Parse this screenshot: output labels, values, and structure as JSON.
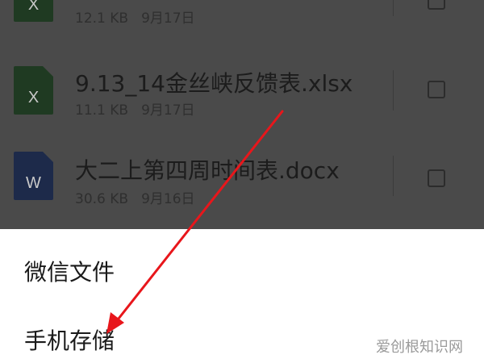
{
  "file_list": {
    "items": [
      {
        "type_icon": "xlsx-file-icon",
        "glyph": "X",
        "name": "",
        "size": "12.1 KB",
        "date": "9月17日"
      },
      {
        "type_icon": "xlsx-file-icon",
        "glyph": "X",
        "name": "9.13_14金丝峡反馈表.xlsx",
        "size": "11.1 KB",
        "date": "9月17日"
      },
      {
        "type_icon": "docx-file-icon",
        "glyph": "W",
        "name": "大二上第四周时间表.docx",
        "size": "30.6 KB",
        "date": "9月16日"
      }
    ]
  },
  "sheet": {
    "options": [
      "微信文件",
      "手机存储"
    ]
  },
  "annotation": {
    "arrow_color": "#e8161b"
  },
  "watermark": "爱创根知识网"
}
